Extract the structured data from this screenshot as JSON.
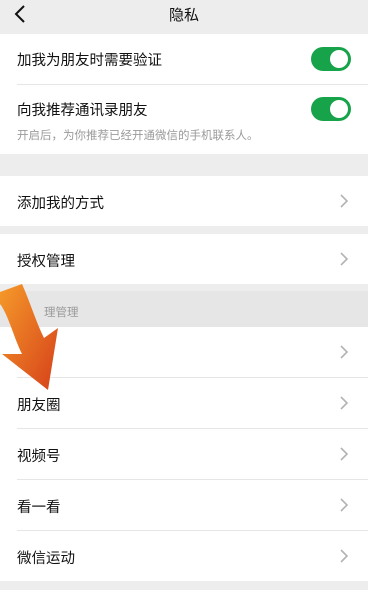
{
  "header": {
    "title": "隐私"
  },
  "verification": {
    "add_me_verify_label": "加我为朋友时需要验证",
    "add_me_verify_on": true,
    "recommend_contacts_label": "向我推荐通讯录朋友",
    "recommend_contacts_on": true,
    "recommend_note": "开启后，为你推荐已经开通微信的手机联系人。"
  },
  "ways_to_add": {
    "label": "添加我的方式"
  },
  "authorization": {
    "label": "授权管理"
  },
  "moments_section": {
    "header_visible_fragment": "理管理",
    "items": [
      {
        "label": ""
      },
      {
        "label": "朋友圈"
      },
      {
        "label": "视频号"
      },
      {
        "label": "看一看"
      },
      {
        "label": "微信运动"
      }
    ]
  },
  "colors": {
    "toggle_on": "#16a34a",
    "overlay_arrow": "#e05a1c"
  }
}
